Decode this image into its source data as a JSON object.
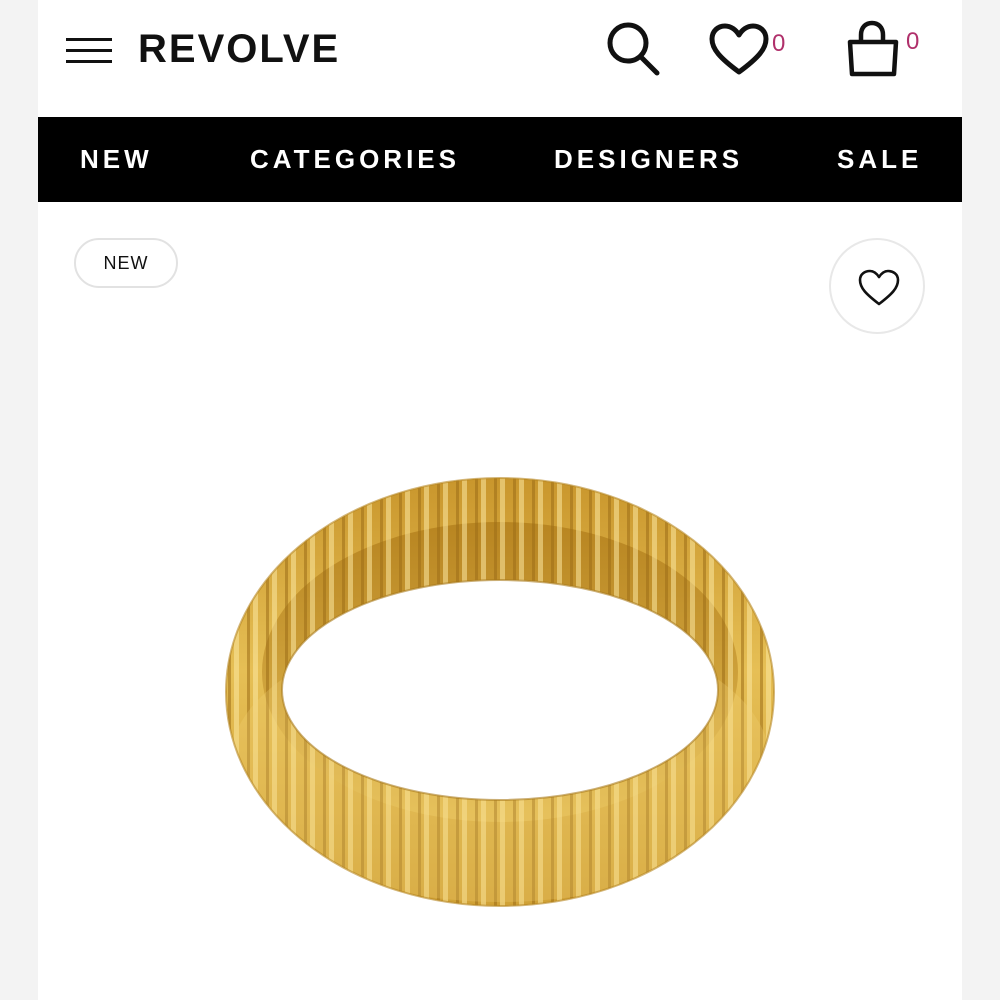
{
  "header": {
    "logo": "REVOLVE",
    "wishlist_count": "0",
    "bag_count": "0"
  },
  "nav": {
    "items": [
      "NEW",
      "CATEGORIES",
      "DESIGNERS",
      "SALE"
    ]
  },
  "product": {
    "badge": "NEW"
  },
  "colors": {
    "accent": "#b0306b",
    "nav_bg": "#000000",
    "gold": "#d9ac3c"
  },
  "icons": [
    "menu-icon",
    "search-icon",
    "heart-icon",
    "shopping-bag-icon",
    "favorite-heart-icon"
  ]
}
